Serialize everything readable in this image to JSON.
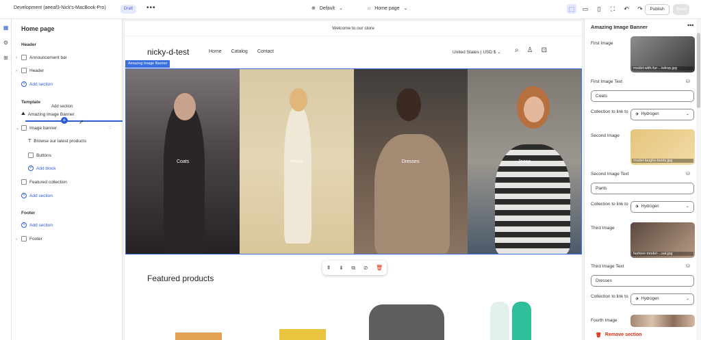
{
  "topbar": {
    "title": "Development (aeeaf3-Nick's-MacBook-Pro)",
    "badge": "Draft",
    "more": "•••",
    "theme": "Default",
    "page": "Home page",
    "publish": "Publish",
    "save": "Save"
  },
  "left": {
    "page_title": "Home page",
    "header_group": "Header",
    "announcement_bar": "Announcement bar",
    "header": "Header",
    "add_section": "Add section",
    "template_group": "Template",
    "tooltip": "Add section",
    "amazing_banner": "Amazing Image Banner",
    "image_banner": "Image banner",
    "browse": "Browse our latest products",
    "buttons": "Buttons",
    "add_block": "Add block",
    "featured_collection": "Featured collection",
    "footer_group": "Footer",
    "footer": "Footer"
  },
  "store": {
    "announcement": "Welcome to our store",
    "logo": "nicky-d-test",
    "nav": [
      "Home",
      "Catalog",
      "Contact"
    ],
    "locale": "United States | USD $",
    "banner_label": "Amazing Image Banner",
    "panels": [
      "Coats",
      "Pants",
      "Dresses",
      "Jeans"
    ],
    "featured_title": "Featured products"
  },
  "right": {
    "title": "Amazing Image Banner",
    "more": "•••",
    "first_image_label": "First Image",
    "first_image_caption": "model-with-fur-...kdrop.jpg",
    "first_text_label": "First Image Text",
    "first_text_value": "Coats",
    "collection_label": "Collection to link to",
    "collection_value": "Hydrogen",
    "second_image_label": "Second Image",
    "second_image_caption": "model-laughs-boots.jpg",
    "second_text_label": "Second Image Text",
    "second_text_value": "Pants",
    "third_image_label": "Third Image",
    "third_image_caption": "fashion-model-...oat.jpg",
    "third_text_label": "Third Image Text",
    "third_text_value": "Dresses",
    "fourth_image_label": "Fourth Image",
    "remove_section": "Remove section"
  },
  "colors": {
    "accent": "#2c5bd4",
    "danger": "#d82c0d"
  }
}
